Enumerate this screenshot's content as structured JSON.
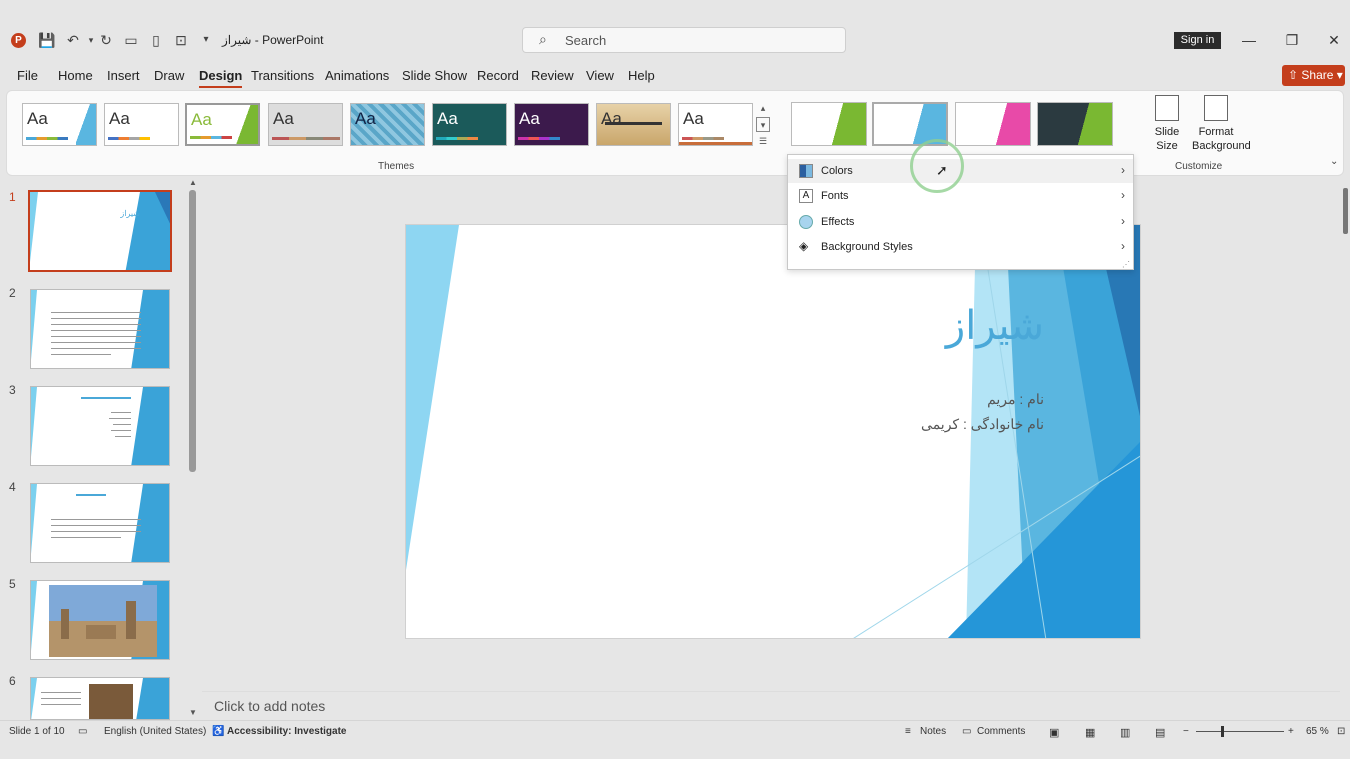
{
  "app": {
    "title": "شیراز  -  PowerPoint",
    "logo_letter": "P"
  },
  "search": {
    "placeholder": "Search"
  },
  "titlebar": {
    "sign_in": "Sign in",
    "minimize": "—",
    "restore": "❐",
    "close": "✕"
  },
  "tabs": [
    "File",
    "Home",
    "Insert",
    "Draw",
    "Design",
    "Transitions",
    "Animations",
    "Slide Show",
    "Record",
    "Review",
    "View",
    "Help"
  ],
  "active_tab": "Design",
  "share": {
    "label": "Share"
  },
  "ribbon": {
    "themes_label": "Themes",
    "theme_aa": "Aa",
    "customize_label": "Customize",
    "slide_size": "Slide Size",
    "format_background_1": "Format",
    "format_background_2": "Background"
  },
  "variants_menu": {
    "items": [
      {
        "label": "Colors",
        "icon": "colors-icon"
      },
      {
        "label": "Fonts",
        "icon": "fonts-icon"
      },
      {
        "label": "Effects",
        "icon": "effects-icon"
      },
      {
        "label": "Background Styles",
        "icon": "background-styles-icon"
      }
    ]
  },
  "slides": {
    "numbers": [
      "1",
      "2",
      "3",
      "4",
      "5",
      "6"
    ],
    "selected": "1"
  },
  "slide": {
    "title": "شیراز",
    "line1": "نام : مریم",
    "line2": "نام خانوادگی : کریمی"
  },
  "notes": {
    "placeholder": "Click to add notes"
  },
  "status": {
    "slide_count": "Slide 1 of 10",
    "language": "English (United States)",
    "accessibility": "Accessibility: Investigate",
    "notes": "Notes",
    "comments": "Comments",
    "zoom": "65 %"
  },
  "colors": {
    "accent": "#c43e1c",
    "theme_blue": "#4aa8d8"
  }
}
